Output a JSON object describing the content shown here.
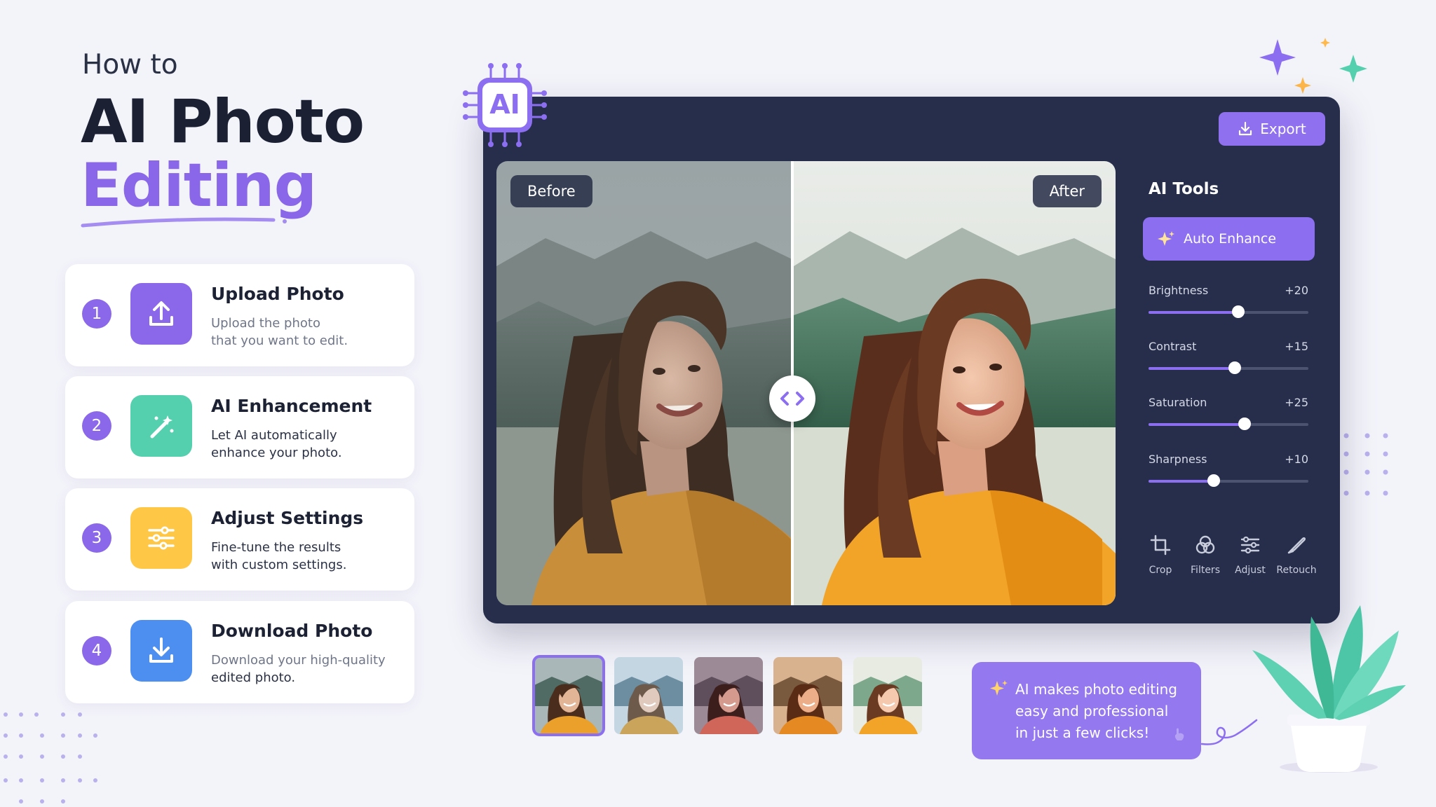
{
  "headline": {
    "kicker": "How to",
    "title_line1": "AI Photo",
    "title_line2": "Editing"
  },
  "steps": [
    {
      "number": "1",
      "title": "Upload Photo",
      "desc_line1": "Upload the photo",
      "desc_line2": "that you want to edit.",
      "icon": "upload-icon",
      "color": "#8b68e9"
    },
    {
      "number": "2",
      "title": "AI Enhancement",
      "desc_line1": "Let AI automatically",
      "desc_line2": "enhance your photo.",
      "icon": "magic-wand-icon",
      "color": "#55d0ae"
    },
    {
      "number": "3",
      "title": "Adjust Settings",
      "desc_line1": "Fine-tune the results",
      "desc_line2": "with custom settings.",
      "icon": "sliders-icon",
      "color": "#ffc746"
    },
    {
      "number": "4",
      "title": "Download Photo",
      "desc_line1": "Download your high-quality",
      "desc_line2": "edited photo.",
      "icon": "download-icon",
      "color": "#4d8ff0"
    }
  ],
  "editor": {
    "chip_label": "AI",
    "export_label": "Export",
    "before_label": "Before",
    "after_label": "After",
    "tools_title": "AI Tools",
    "auto_enhance_label": "Auto Enhance",
    "sliders": [
      {
        "label": "Brightness",
        "value": "+20",
        "level": 0.56
      },
      {
        "label": "Contrast",
        "value": "+15",
        "level": 0.54
      },
      {
        "label": "Saturation",
        "value": "+25",
        "level": 0.6
      },
      {
        "label": "Sharpness",
        "value": "+10",
        "level": 0.41
      }
    ],
    "tools": [
      {
        "label": "Crop",
        "icon": "crop-icon"
      },
      {
        "label": "Filters",
        "icon": "filters-icon"
      },
      {
        "label": "Adjust",
        "icon": "adjust-icon"
      },
      {
        "label": "Retouch",
        "icon": "retouch-icon"
      }
    ]
  },
  "thumbnails": {
    "count": 5,
    "selected_index": 0,
    "filters": [
      "original",
      "cool",
      "rose",
      "warm",
      "bright"
    ]
  },
  "callout": {
    "line1": "AI makes photo editing",
    "line2": "easy and professional",
    "line3": "in just a few clicks!"
  },
  "colors": {
    "accent": "#8b68e9",
    "editor_bg": "#262e4c",
    "page_bg": "#f3f3fa",
    "hoodie": "#f2a428"
  }
}
